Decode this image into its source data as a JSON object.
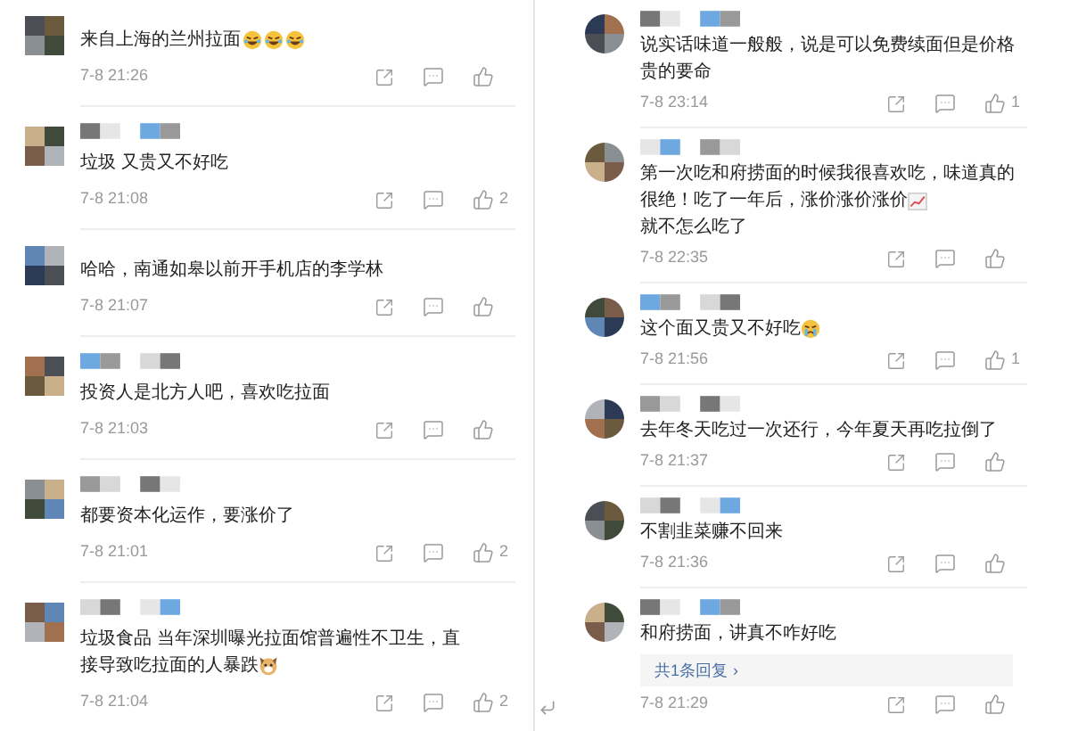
{
  "columns": [
    {
      "rounded_avatars": false,
      "comments": [
        {
          "show_name": false,
          "segments": [
            {
              "kind": "text",
              "text": "来自上海的兰州拉面"
            },
            {
              "kind": "laughing-emoji"
            },
            {
              "kind": "laughing-emoji"
            },
            {
              "kind": "laughing-emoji"
            }
          ],
          "time": "7-8 21:26"
        },
        {
          "show_name": true,
          "segments": [
            {
              "kind": "text",
              "text": "垃圾 又贵又不好吃"
            }
          ],
          "time": "7-8 21:08",
          "likes": "2"
        },
        {
          "show_name": false,
          "segments": [
            {
              "kind": "text",
              "text": "哈哈，南通如皋以前开手机店的李学林"
            }
          ],
          "time": "7-8 21:07"
        },
        {
          "show_name": true,
          "segments": [
            {
              "kind": "text",
              "text": "投资人是北方人吧，喜欢吃拉面"
            }
          ],
          "time": "7-8 21:03"
        },
        {
          "show_name": true,
          "segments": [
            {
              "kind": "text",
              "text": "都要资本化运作，要涨价了"
            }
          ],
          "time": "7-8 21:01",
          "likes": "2"
        },
        {
          "show_name": true,
          "segments": [
            {
              "kind": "text",
              "text": "垃圾食品 当年深圳曝光拉面馆普遍性不卫生，直"
            },
            {
              "kind": "text",
              "text": "接导致吃拉面的人暴跌"
            },
            {
              "kind": "dog-emoji"
            }
          ],
          "time": "7-8 21:04",
          "likes": "2"
        }
      ]
    },
    {
      "rounded_avatars": true,
      "comments": [
        {
          "show_name": true,
          "segments": [
            {
              "kind": "text",
              "text": "说实话味道一般般，说是可以免费续面但是价格贵的要命"
            }
          ],
          "time": "7-8 23:14",
          "likes": "1"
        },
        {
          "show_name": true,
          "segments": [
            {
              "kind": "text",
              "text": "第一次吃和府捞面的时候我很喜欢吃，味道真的"
            },
            {
              "kind": "text",
              "text": "很绝！吃了一年后，涨价涨价涨价"
            },
            {
              "kind": "chart-emoji"
            },
            {
              "kind": "text",
              "text": "就不怎么吃了"
            }
          ],
          "time": "7-8 22:35"
        },
        {
          "show_name": true,
          "segments": [
            {
              "kind": "text",
              "text": "这个面又贵又不好吃"
            },
            {
              "kind": "crying-emoji"
            }
          ],
          "time": "7-8 21:56",
          "likes": "1"
        },
        {
          "show_name": true,
          "segments": [
            {
              "kind": "text",
              "text": "去年冬天吃过一次还行，今年夏天再吃拉倒了"
            }
          ],
          "time": "7-8 21:37"
        },
        {
          "show_name": true,
          "segments": [
            {
              "kind": "text",
              "text": "不割韭菜赚不回来"
            }
          ],
          "time": "7-8 21:36"
        },
        {
          "show_name": true,
          "segments": [
            {
              "kind": "text",
              "text": "和府捞面，讲真不咋好吃"
            }
          ],
          "reply": "共1条回复",
          "reply_arrow": "›",
          "time": "7-8 21:29"
        }
      ]
    }
  ]
}
